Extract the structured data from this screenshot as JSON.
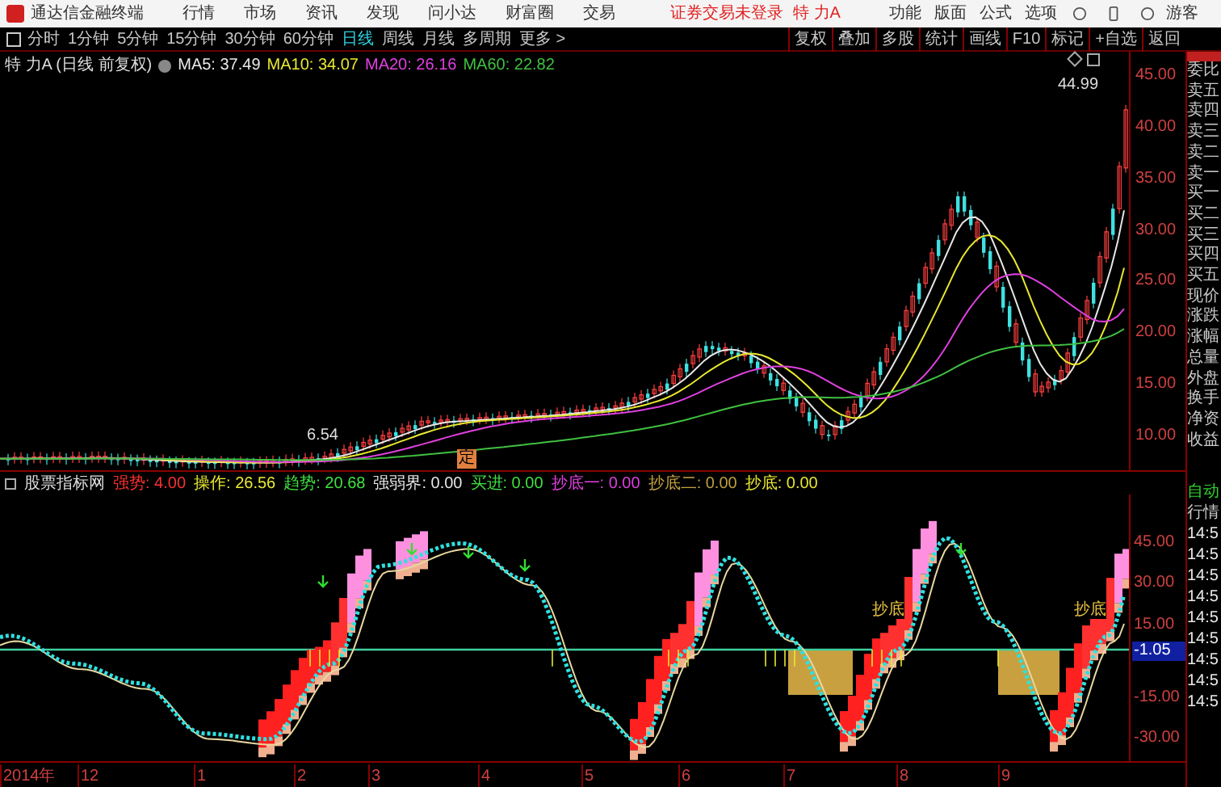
{
  "app": {
    "name": "通达信金融终端",
    "menu": [
      "行情",
      "市场",
      "资讯",
      "发现",
      "问小达",
      "财富圈",
      "交易"
    ],
    "notice": "证券交易未登录",
    "stock": "特 力A",
    "right_menu": [
      "功能",
      "版面",
      "公式",
      "选项"
    ],
    "user": "游客"
  },
  "periods": [
    {
      "label": "分时",
      "selected": false
    },
    {
      "label": "1分钟",
      "selected": false
    },
    {
      "label": "5分钟",
      "selected": false
    },
    {
      "label": "15分钟",
      "selected": false
    },
    {
      "label": "30分钟",
      "selected": false
    },
    {
      "label": "60分钟",
      "selected": false
    },
    {
      "label": "日线",
      "selected": true
    },
    {
      "label": "周线",
      "selected": false
    },
    {
      "label": "月线",
      "selected": false
    },
    {
      "label": "多周期",
      "selected": false
    },
    {
      "label": "更多 >",
      "selected": false
    }
  ],
  "tools": [
    "复权",
    "叠加",
    "多股",
    "统计",
    "画线",
    "F10",
    "标记",
    "+自选",
    "返回"
  ],
  "chart": {
    "title": "特 力A (日线 前复权)",
    "ma": [
      {
        "label": "MA5: 37.49",
        "color": "#e8e8e8"
      },
      {
        "label": "MA10: 34.07",
        "color": "#e8e830"
      },
      {
        "label": "MA20: 26.16",
        "color": "#e040e0"
      },
      {
        "label": "MA60: 22.82",
        "color": "#40c040"
      }
    ],
    "high_label": "44.99",
    "low_label": "6.54",
    "marker": "定",
    "axis": [
      "45.00",
      "40.00",
      "35.00",
      "30.00",
      "25.00",
      "20.00",
      "15.00",
      "10.00"
    ]
  },
  "indicator": {
    "title": "股票指标网",
    "values": [
      {
        "label": "强势: 4.00",
        "color": "#ff3030"
      },
      {
        "label": "操作: 26.56",
        "color": "#e8e830"
      },
      {
        "label": "趋势: 20.68",
        "color": "#40e040"
      },
      {
        "label": "强弱界: 0.00",
        "color": "#e8e8e8"
      },
      {
        "label": "买进: 0.00",
        "color": "#40e040"
      },
      {
        "label": "抄底一: 0.00",
        "color": "#e040e0"
      },
      {
        "label": "抄底二: 0.00",
        "color": "#c0a040"
      },
      {
        "label": "抄底: 0.00",
        "color": "#e8e830"
      }
    ],
    "tags": [
      "抄底",
      "抄底"
    ],
    "axis": [
      {
        "label": "45.00",
        "selected": false
      },
      {
        "label": "30.00",
        "selected": false
      },
      {
        "label": "15.00",
        "selected": false
      },
      {
        "label": "-1.05",
        "selected": true
      },
      {
        "label": "-15.00",
        "selected": false
      },
      {
        "label": "-30.00",
        "selected": false
      }
    ]
  },
  "dates": [
    "2014年",
    "12",
    "1",
    "2",
    "3",
    "4",
    "5",
    "6",
    "7",
    "8",
    "9"
  ],
  "quote_panel": {
    "fields": [
      "委比",
      "卖五",
      "卖四",
      "卖三",
      "卖二",
      "卖一",
      "买一",
      "买二",
      "买三",
      "买四",
      "买五",
      "现价",
      "涨跌",
      "涨幅",
      "总量",
      "外盘",
      "换手",
      "净资",
      "收益"
    ],
    "header": [
      "自动",
      "行情"
    ],
    "times": [
      "14:5",
      "14:5",
      "14:5",
      "14:5",
      "14:5",
      "14:5",
      "14:5",
      "14:5",
      "14:5"
    ]
  }
}
